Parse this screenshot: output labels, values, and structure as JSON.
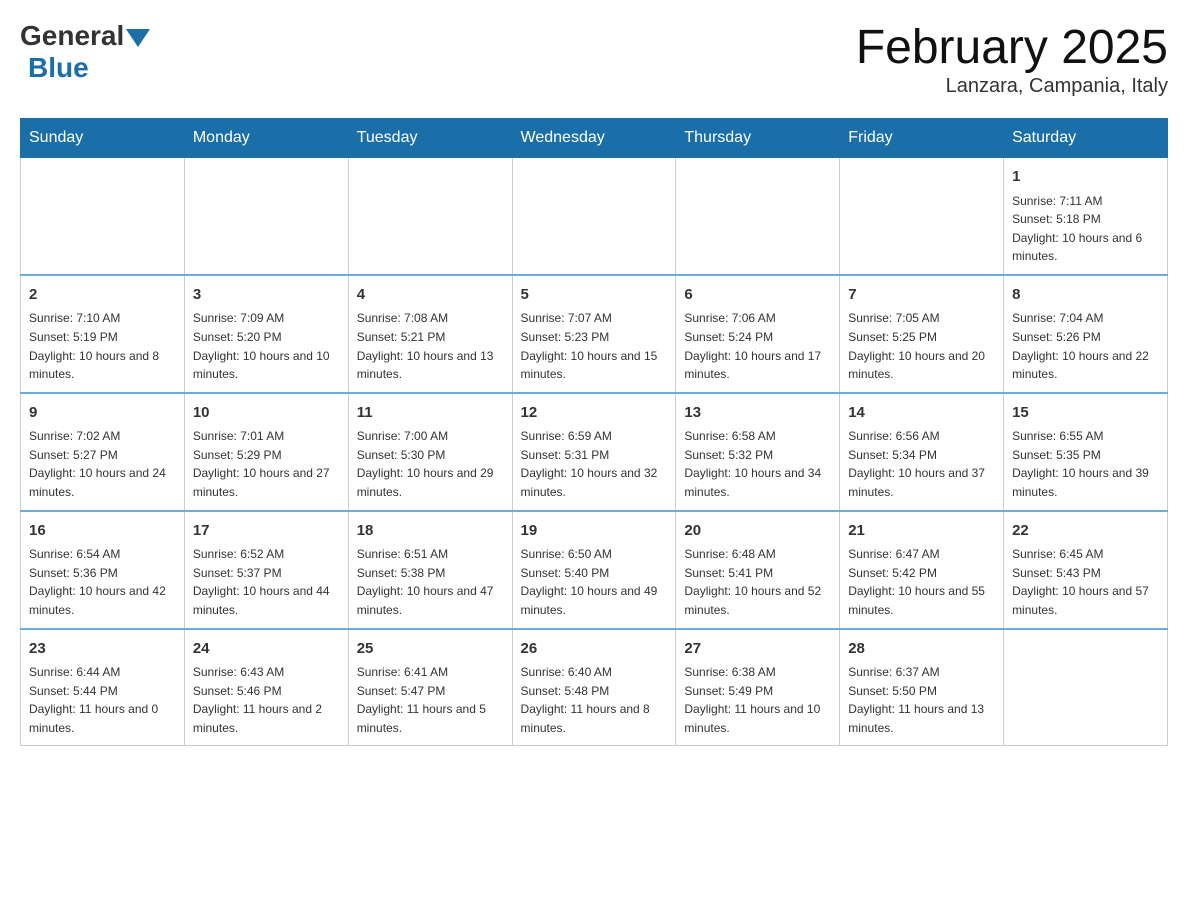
{
  "header": {
    "logo_general": "General",
    "logo_blue": "Blue",
    "title": "February 2025",
    "subtitle": "Lanzara, Campania, Italy"
  },
  "days_of_week": [
    "Sunday",
    "Monday",
    "Tuesday",
    "Wednesday",
    "Thursday",
    "Friday",
    "Saturday"
  ],
  "weeks": [
    [
      {
        "day": "",
        "info": ""
      },
      {
        "day": "",
        "info": ""
      },
      {
        "day": "",
        "info": ""
      },
      {
        "day": "",
        "info": ""
      },
      {
        "day": "",
        "info": ""
      },
      {
        "day": "",
        "info": ""
      },
      {
        "day": "1",
        "info": "Sunrise: 7:11 AM\nSunset: 5:18 PM\nDaylight: 10 hours and 6 minutes."
      }
    ],
    [
      {
        "day": "2",
        "info": "Sunrise: 7:10 AM\nSunset: 5:19 PM\nDaylight: 10 hours and 8 minutes."
      },
      {
        "day": "3",
        "info": "Sunrise: 7:09 AM\nSunset: 5:20 PM\nDaylight: 10 hours and 10 minutes."
      },
      {
        "day": "4",
        "info": "Sunrise: 7:08 AM\nSunset: 5:21 PM\nDaylight: 10 hours and 13 minutes."
      },
      {
        "day": "5",
        "info": "Sunrise: 7:07 AM\nSunset: 5:23 PM\nDaylight: 10 hours and 15 minutes."
      },
      {
        "day": "6",
        "info": "Sunrise: 7:06 AM\nSunset: 5:24 PM\nDaylight: 10 hours and 17 minutes."
      },
      {
        "day": "7",
        "info": "Sunrise: 7:05 AM\nSunset: 5:25 PM\nDaylight: 10 hours and 20 minutes."
      },
      {
        "day": "8",
        "info": "Sunrise: 7:04 AM\nSunset: 5:26 PM\nDaylight: 10 hours and 22 minutes."
      }
    ],
    [
      {
        "day": "9",
        "info": "Sunrise: 7:02 AM\nSunset: 5:27 PM\nDaylight: 10 hours and 24 minutes."
      },
      {
        "day": "10",
        "info": "Sunrise: 7:01 AM\nSunset: 5:29 PM\nDaylight: 10 hours and 27 minutes."
      },
      {
        "day": "11",
        "info": "Sunrise: 7:00 AM\nSunset: 5:30 PM\nDaylight: 10 hours and 29 minutes."
      },
      {
        "day": "12",
        "info": "Sunrise: 6:59 AM\nSunset: 5:31 PM\nDaylight: 10 hours and 32 minutes."
      },
      {
        "day": "13",
        "info": "Sunrise: 6:58 AM\nSunset: 5:32 PM\nDaylight: 10 hours and 34 minutes."
      },
      {
        "day": "14",
        "info": "Sunrise: 6:56 AM\nSunset: 5:34 PM\nDaylight: 10 hours and 37 minutes."
      },
      {
        "day": "15",
        "info": "Sunrise: 6:55 AM\nSunset: 5:35 PM\nDaylight: 10 hours and 39 minutes."
      }
    ],
    [
      {
        "day": "16",
        "info": "Sunrise: 6:54 AM\nSunset: 5:36 PM\nDaylight: 10 hours and 42 minutes."
      },
      {
        "day": "17",
        "info": "Sunrise: 6:52 AM\nSunset: 5:37 PM\nDaylight: 10 hours and 44 minutes."
      },
      {
        "day": "18",
        "info": "Sunrise: 6:51 AM\nSunset: 5:38 PM\nDaylight: 10 hours and 47 minutes."
      },
      {
        "day": "19",
        "info": "Sunrise: 6:50 AM\nSunset: 5:40 PM\nDaylight: 10 hours and 49 minutes."
      },
      {
        "day": "20",
        "info": "Sunrise: 6:48 AM\nSunset: 5:41 PM\nDaylight: 10 hours and 52 minutes."
      },
      {
        "day": "21",
        "info": "Sunrise: 6:47 AM\nSunset: 5:42 PM\nDaylight: 10 hours and 55 minutes."
      },
      {
        "day": "22",
        "info": "Sunrise: 6:45 AM\nSunset: 5:43 PM\nDaylight: 10 hours and 57 minutes."
      }
    ],
    [
      {
        "day": "23",
        "info": "Sunrise: 6:44 AM\nSunset: 5:44 PM\nDaylight: 11 hours and 0 minutes."
      },
      {
        "day": "24",
        "info": "Sunrise: 6:43 AM\nSunset: 5:46 PM\nDaylight: 11 hours and 2 minutes."
      },
      {
        "day": "25",
        "info": "Sunrise: 6:41 AM\nSunset: 5:47 PM\nDaylight: 11 hours and 5 minutes."
      },
      {
        "day": "26",
        "info": "Sunrise: 6:40 AM\nSunset: 5:48 PM\nDaylight: 11 hours and 8 minutes."
      },
      {
        "day": "27",
        "info": "Sunrise: 6:38 AM\nSunset: 5:49 PM\nDaylight: 11 hours and 10 minutes."
      },
      {
        "day": "28",
        "info": "Sunrise: 6:37 AM\nSunset: 5:50 PM\nDaylight: 11 hours and 13 minutes."
      },
      {
        "day": "",
        "info": ""
      }
    ]
  ]
}
